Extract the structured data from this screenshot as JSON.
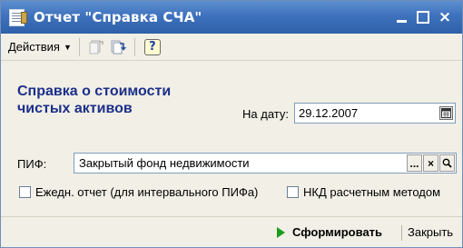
{
  "window": {
    "title": "Отчет \"Справка СЧА\"",
    "controls": {
      "minimize": "_",
      "maximize": "□",
      "close": "×"
    }
  },
  "toolbar": {
    "actions_label": "Действия",
    "help_label": "?"
  },
  "heading": {
    "line1": "Справка о стоимости",
    "line2": "чистых активов"
  },
  "date": {
    "label": "На дату:",
    "value": "29.12.2007"
  },
  "pif": {
    "label": "ПИФ:",
    "value": "Закрытый фонд недвижимости",
    "select_btn": "...",
    "clear_btn": "×"
  },
  "options": {
    "daily_report": {
      "label": "Ежедн. отчет (для интервального ПИФа)",
      "checked": false
    },
    "nkd_calc": {
      "label": "НКД расчетным методом",
      "checked": false
    }
  },
  "footer": {
    "generate_label": "Сформировать",
    "close_label": "Закрыть"
  },
  "colors": {
    "titlebar": "#3f72bd",
    "heading": "#1c2f8a",
    "panel": "#f1efe6",
    "run_arrow": "#1d9b1d"
  }
}
